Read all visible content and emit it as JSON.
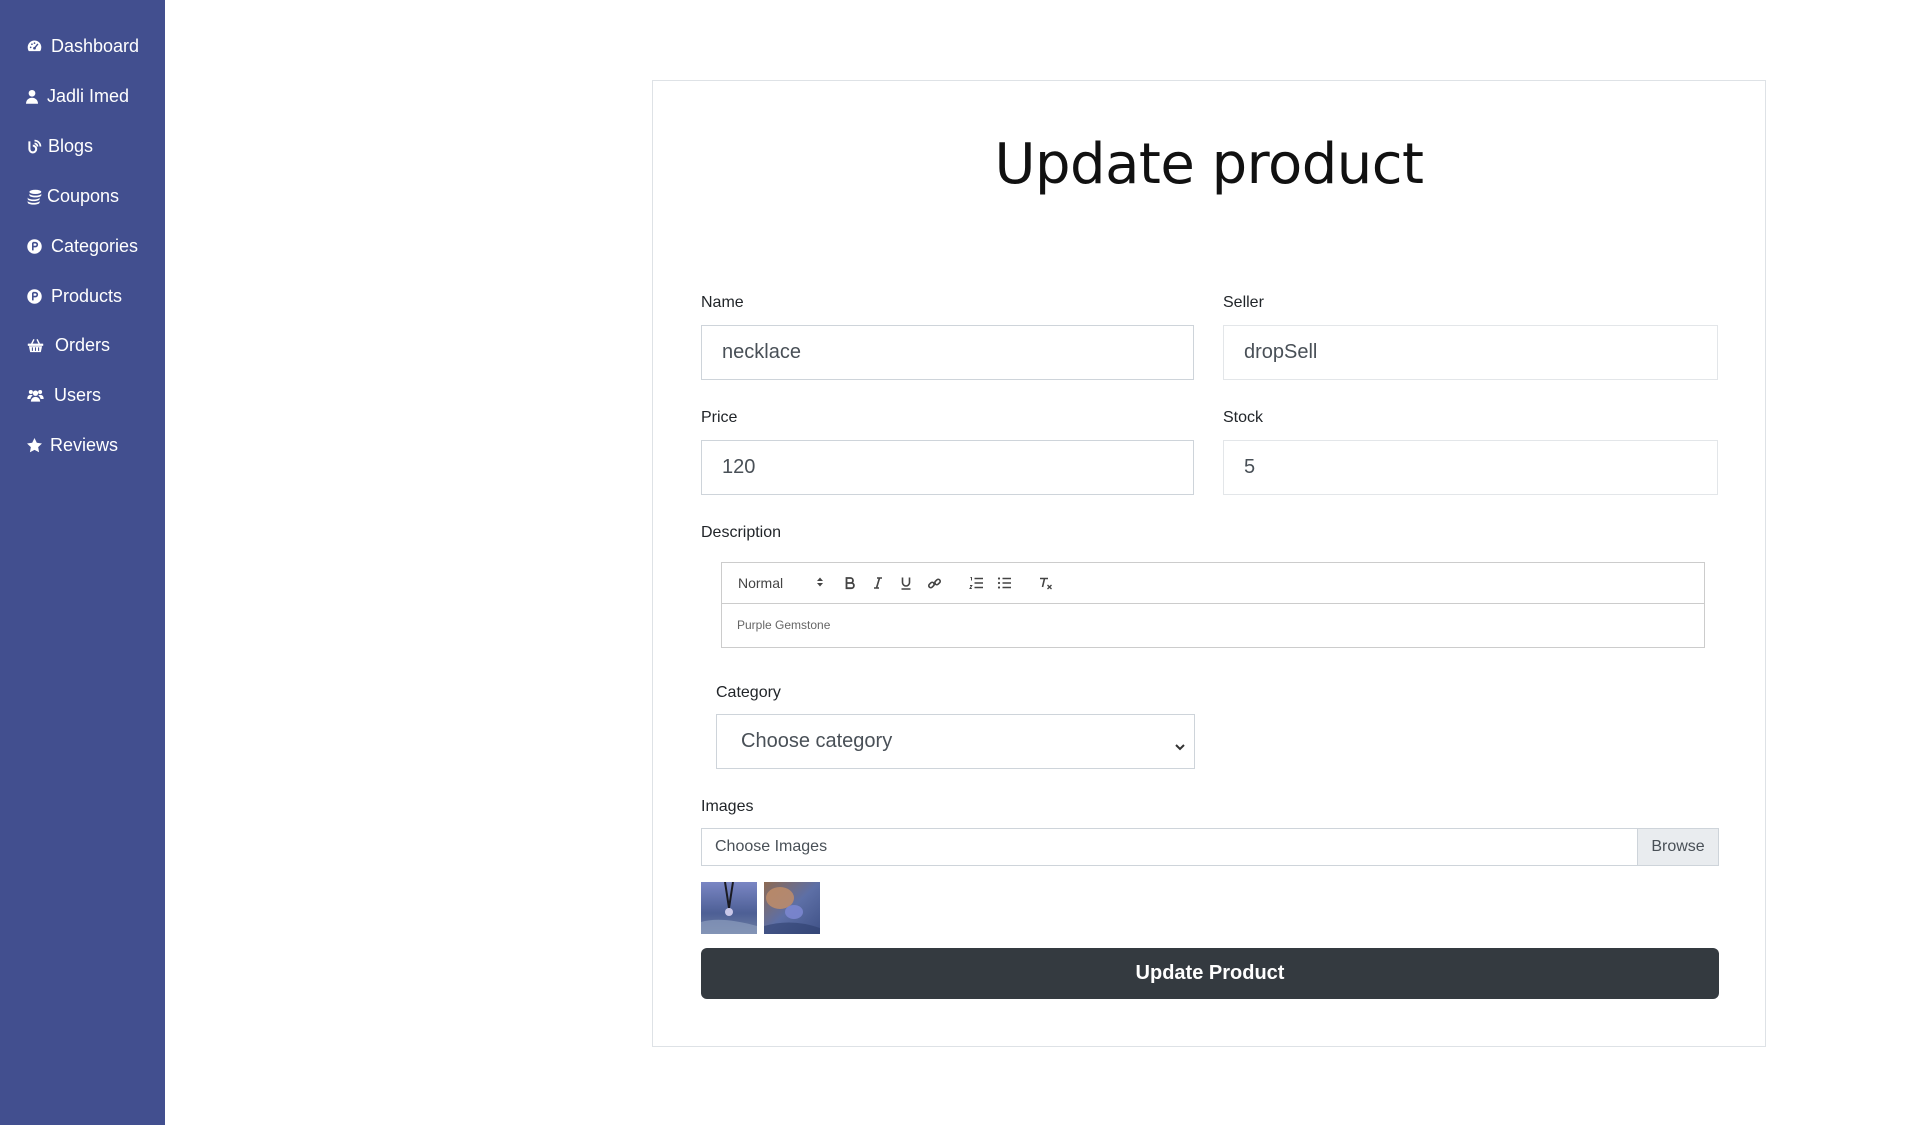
{
  "sidebar": {
    "items": [
      {
        "label": "Dashboard",
        "icon": "tachometer-icon"
      },
      {
        "label": "Jadli Imed",
        "icon": "user-icon"
      },
      {
        "label": "Blogs",
        "icon": "blog-icon"
      },
      {
        "label": "Coupons",
        "icon": "coins-icon"
      },
      {
        "label": "Categories",
        "icon": "product-hunt-icon"
      },
      {
        "label": "Products",
        "icon": "product-hunt-icon"
      },
      {
        "label": "Orders",
        "icon": "shopping-basket-icon"
      },
      {
        "label": "Users",
        "icon": "users-icon"
      },
      {
        "label": "Reviews",
        "icon": "star-icon"
      }
    ],
    "background": "#424f8f"
  },
  "form": {
    "title": "Update product",
    "name": {
      "label": "Name",
      "value": "necklace"
    },
    "seller": {
      "label": "Seller",
      "value": "dropSell"
    },
    "price": {
      "label": "Price",
      "value": "120"
    },
    "stock": {
      "label": "Stock",
      "value": "5"
    },
    "description": {
      "label": "Description",
      "format": "Normal",
      "content": "Purple Gemstone"
    },
    "category": {
      "label": "Category",
      "selected": "Choose category"
    },
    "images": {
      "label": "Images",
      "placeholder": "Choose Images",
      "browse_label": "Browse"
    },
    "submit_label": "Update Product",
    "submit_color": "#343a40"
  }
}
